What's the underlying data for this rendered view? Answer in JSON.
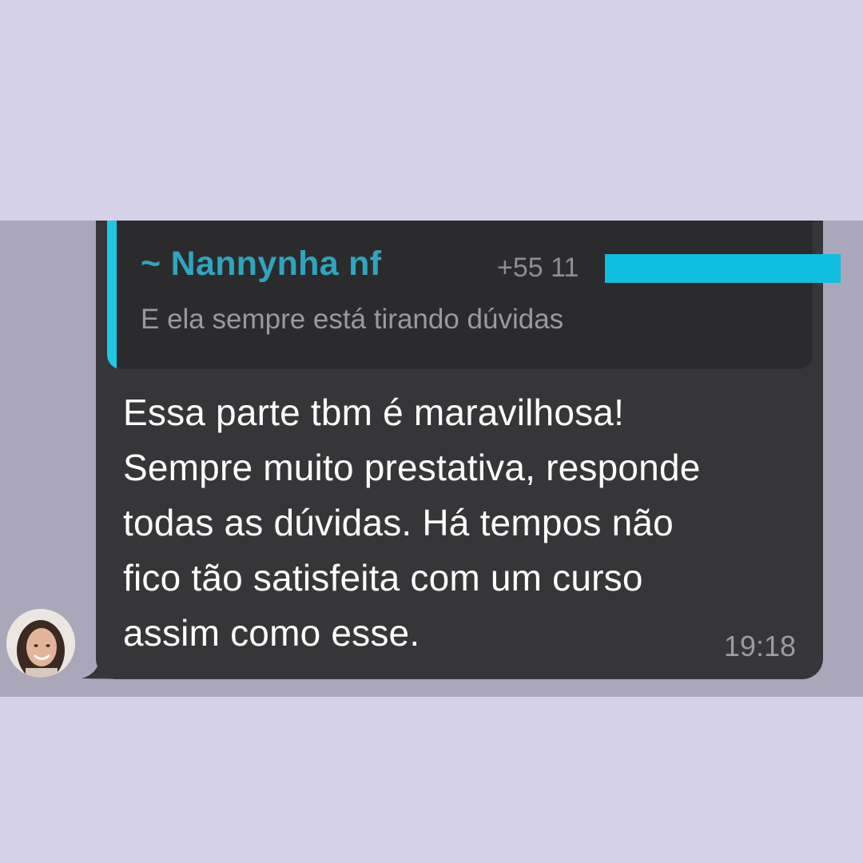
{
  "quoted_message": {
    "sender_name": "~ Nannynha nf",
    "sender_phone": "+55 11",
    "text": "E ela sempre está tirando dúvidas"
  },
  "message": {
    "text": "Essa parte tbm é maravilhosa!\nSempre muito prestativa, responde\ntodas as dúvidas. Há tempos não\nfico tão satisfeita com um curso\nassim como esse.",
    "time": "19:18"
  },
  "colors": {
    "page_background": "#d6d3e8",
    "chat_background": "#aaa7ba",
    "bubble_background": "#363638",
    "quote_background": "#2b2b2d",
    "quote_accent": "#1ec8e3",
    "sender_name_color": "#2ea6be",
    "redaction_color": "#0fbfe0"
  },
  "icons": {
    "avatar": "user-avatar-photo"
  }
}
